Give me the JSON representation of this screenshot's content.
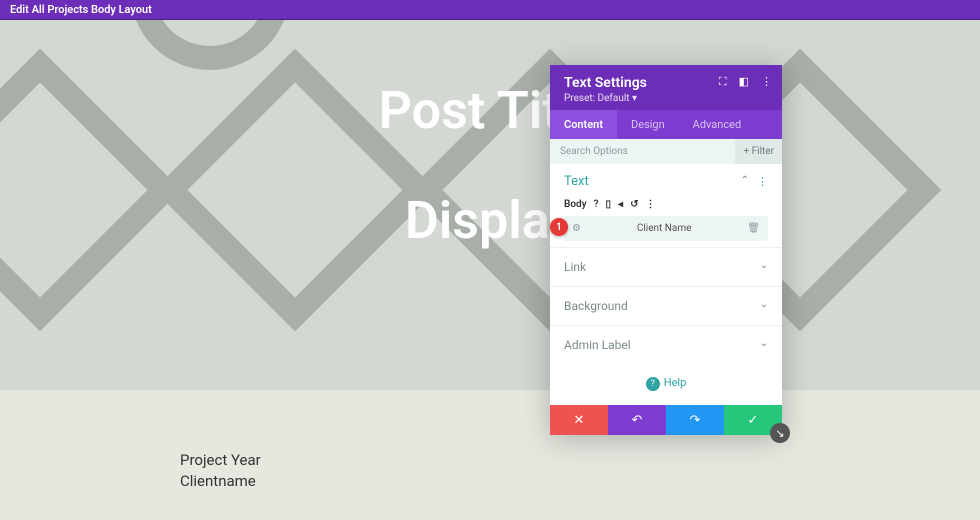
{
  "topbar": {
    "title": "Edit All Projects Body Layout"
  },
  "hero": {
    "post_title": "Post Title",
    "display": "Display "
  },
  "meta": {
    "line1": "Project Year",
    "line2": "Clientname"
  },
  "modal": {
    "title": "Text Settings",
    "preset": "Preset: Default ▾",
    "tabs": {
      "content": "Content",
      "design": "Design",
      "advanced": "Advanced"
    },
    "search": {
      "placeholder": "Search Options",
      "filter": "Filter"
    },
    "section": {
      "title": "Text",
      "body_label": "Body",
      "field_value": "Client Name"
    },
    "collapsed": {
      "link": "Link",
      "background": "Background",
      "admin_label": "Admin Label"
    },
    "help": "Help",
    "tip": "1"
  }
}
